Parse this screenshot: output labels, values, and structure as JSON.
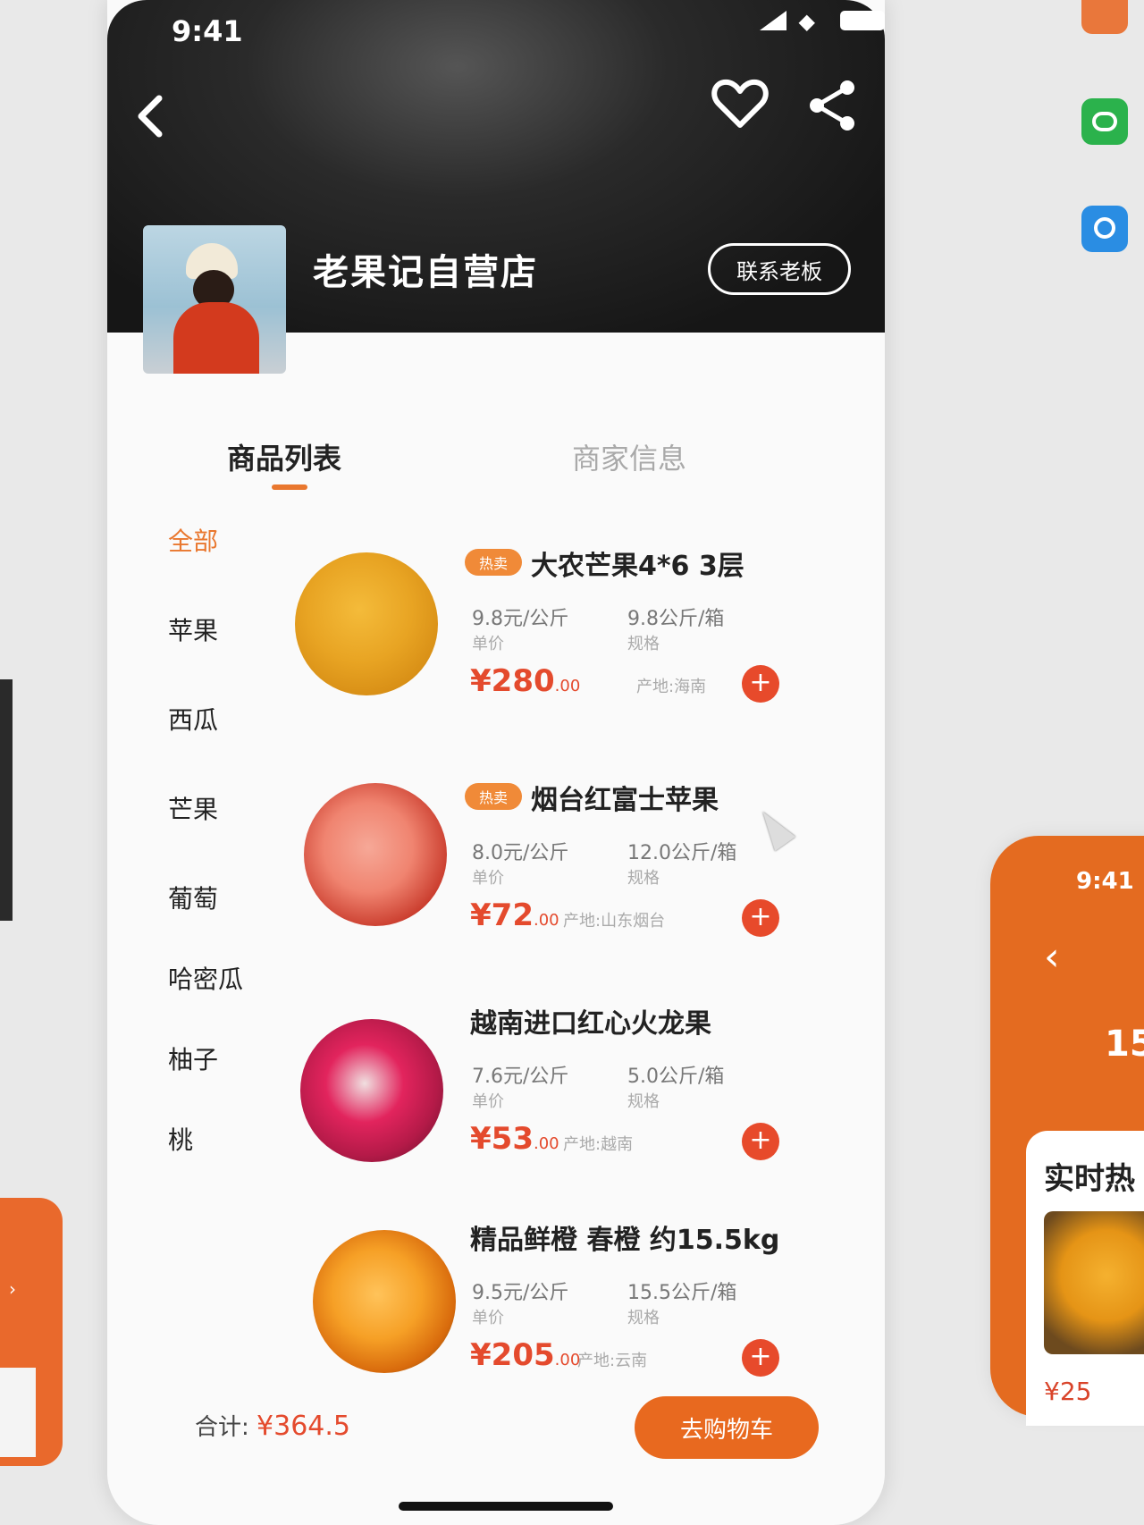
{
  "status_bar": {
    "time": "9:41"
  },
  "store": {
    "name": "老果记自营店",
    "contact_label": "联系老板"
  },
  "tabs": [
    {
      "label": "商品列表",
      "active": true
    },
    {
      "label": "商家信息",
      "active": false
    }
  ],
  "categories": [
    {
      "label": "全部",
      "active": true
    },
    {
      "label": "苹果"
    },
    {
      "label": "西瓜"
    },
    {
      "label": "芒果"
    },
    {
      "label": "葡萄"
    },
    {
      "label": "哈密瓜"
    },
    {
      "label": "柚子"
    },
    {
      "label": "桃"
    }
  ],
  "products": [
    {
      "tag": "热卖",
      "name": "大农芒果4*6 3层",
      "unit_price": "9.8元/公斤",
      "unit_price_label": "单价",
      "spec": "9.8公斤/箱",
      "spec_label": "规格",
      "price": "¥280",
      "price_decimal": ".00",
      "origin": "产地:海南",
      "image_colors": [
        "#f4bb3a",
        "#d88f16"
      ]
    },
    {
      "tag": "热卖",
      "name": "烟台红富士苹果",
      "unit_price": "8.0元/公斤",
      "unit_price_label": "单价",
      "spec": "12.0公斤/箱",
      "spec_label": "规格",
      "price": "¥72",
      "price_decimal": ".00",
      "origin": "产地:山东烟台",
      "image_colors": [
        "#f08470",
        "#c8392a"
      ]
    },
    {
      "tag": "",
      "name": "越南进口红心火龙果",
      "unit_price": "7.6元/公斤",
      "unit_price_label": "单价",
      "spec": "5.0公斤/箱",
      "spec_label": "规格",
      "price": "¥53",
      "price_decimal": ".00",
      "origin": "产地:越南",
      "image_colors": [
        "#e2245d",
        "#8e1238"
      ]
    },
    {
      "tag": "",
      "name": "精品鲜橙 春橙 约15.5kg",
      "unit_price": "9.5元/公斤",
      "unit_price_label": "单价",
      "spec": "15.5公斤/箱",
      "spec_label": "规格",
      "price": "¥205",
      "price_decimal": ".00",
      "origin": "产地:云南",
      "image_colors": [
        "#f6a026",
        "#d86a0c"
      ]
    }
  ],
  "footer": {
    "total_label": "合计:",
    "total_value": "¥364.5",
    "checkout_label": "去购物车"
  },
  "side_preview": {
    "time": "9:41",
    "number": "15",
    "section_title": "实时热",
    "price": "¥25"
  },
  "colors": {
    "accent": "#e9772e",
    "price": "#e44a2d",
    "hero_bg": "#1c1c1c"
  },
  "icons": [
    "back-icon",
    "heart-icon",
    "share-icon",
    "plus-icon"
  ]
}
